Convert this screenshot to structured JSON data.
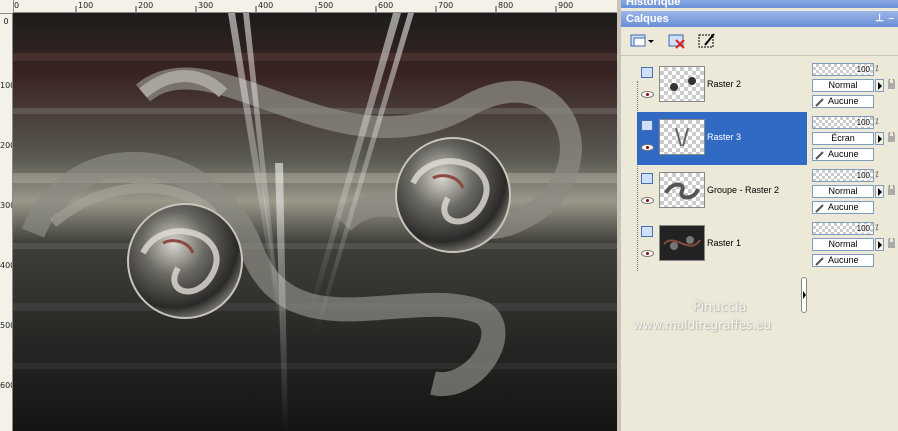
{
  "rulers": {
    "top": [
      "0",
      "100",
      "200",
      "300",
      "400",
      "500",
      "600",
      "700",
      "800",
      "900"
    ],
    "left": [
      "0",
      "100",
      "200",
      "300",
      "400",
      "500",
      "600"
    ]
  },
  "panels": {
    "history": {
      "title": "Historique"
    },
    "layers": {
      "title": "Calques"
    }
  },
  "toolbar": {
    "icons": [
      "new-layer-icon",
      "dropdown-arrow-icon",
      "delete-layer-icon",
      "edit-selection-icon"
    ]
  },
  "layers": [
    {
      "name": "Raster 2",
      "opacity": "100",
      "blend": "Normal",
      "mask": "Aucune",
      "selected": false
    },
    {
      "name": "Raster 3",
      "opacity": "100",
      "blend": "Écran",
      "mask": "Aucune",
      "selected": true
    },
    {
      "name": "Groupe - Raster 2",
      "opacity": "100",
      "blend": "Normal",
      "mask": "Aucune",
      "selected": false
    },
    {
      "name": "Raster 1",
      "opacity": "100",
      "blend": "Normal",
      "mask": "Aucune",
      "selected": false
    }
  ],
  "watermark": {
    "line1": "Pinuccia",
    "line2": "www.maldiregraffes.eu"
  },
  "colors": {
    "selection": "#316ac5",
    "panel_title": "#6a8fd8"
  }
}
